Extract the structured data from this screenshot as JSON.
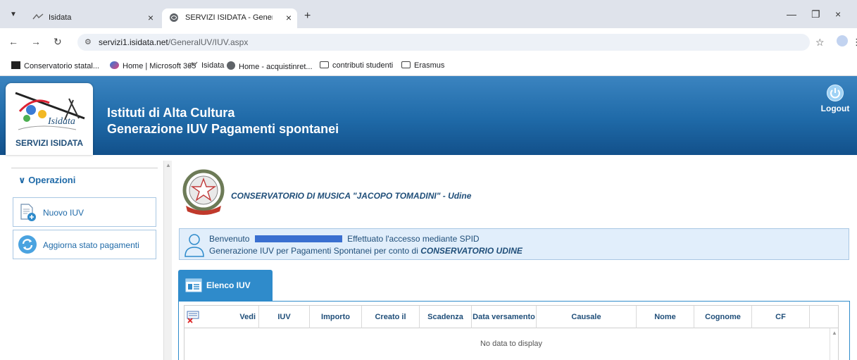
{
  "browser": {
    "tabs": [
      {
        "label": "Isidata",
        "active": false
      },
      {
        "label": "SERVIZI ISIDATA - Generazione",
        "active": true
      }
    ],
    "new_tab": "+",
    "url_host": "servizi1.isidata.net",
    "url_path": "/GeneralUV/IUV.aspx",
    "bookmarks": [
      {
        "label": "Conservatorio statal...",
        "icon": "black-square-icon"
      },
      {
        "label": "Home | Microsoft 365",
        "icon": "m365-icon"
      },
      {
        "label": "Isidata",
        "icon": "isidata-icon"
      },
      {
        "label": "Home - acquistinret...",
        "icon": "globe-icon"
      },
      {
        "label": "contributi studenti",
        "icon": "folder-icon"
      },
      {
        "label": "Erasmus",
        "icon": "folder-icon"
      }
    ]
  },
  "header": {
    "title_line1": "Istituti di Alta Cultura",
    "title_line2": "Generazione IUV Pagamenti spontanei",
    "logo_label": "SERVIZI ISIDATA",
    "logout_label": "Logout",
    "colors": {
      "header_top": "#3b84c0",
      "header_bottom": "#12508a"
    }
  },
  "sidebar": {
    "heading": "Operazioni",
    "items": [
      {
        "label": "Nuovo IUV",
        "icon": "new-document-icon"
      },
      {
        "label": "Aggiorna stato pagamenti",
        "icon": "refresh-icon"
      }
    ]
  },
  "main": {
    "institution": "CONSERVATORIO DI MUSICA \"JACOPO TOMADINI\" - Udine",
    "welcome": {
      "prefix": "Benvenuto",
      "access_text": "Effettuato l'accesso mediante SPID",
      "line2_prefix": "Generazione IUV per Pagamenti Spontanei per conto di",
      "line2_org": "CONSERVATORIO UDINE"
    },
    "tab_label": "Elenco IUV",
    "grid": {
      "columns": [
        "Vedi",
        "IUV",
        "Importo",
        "Creato il",
        "Scadenza",
        "Data versamento",
        "Causale",
        "Nome",
        "Cognome",
        "CF"
      ],
      "empty_text": "No data to display"
    }
  }
}
